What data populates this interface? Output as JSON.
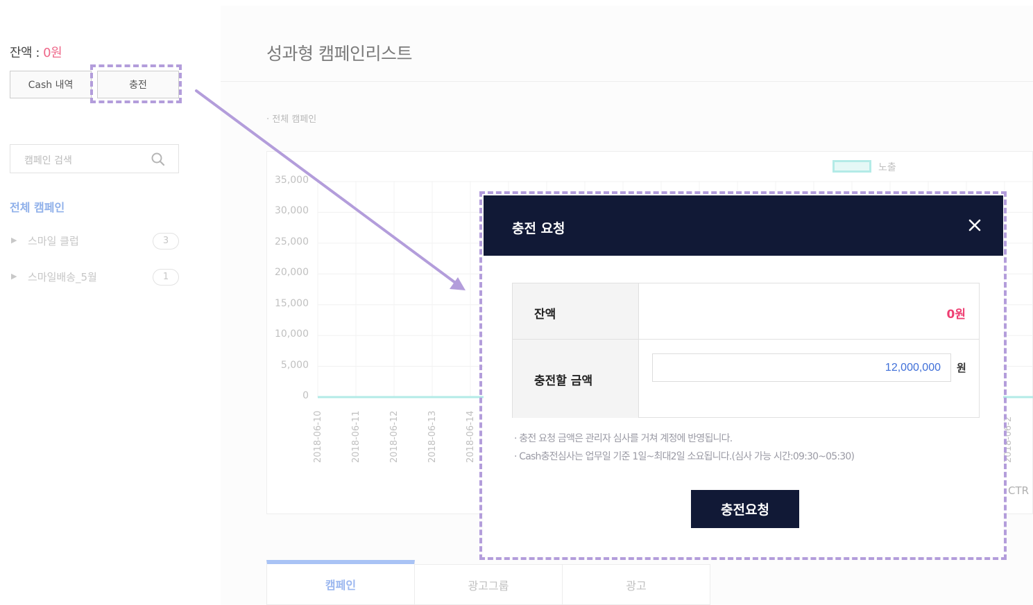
{
  "sidebar": {
    "balance_label": "잔액 : ",
    "balance_value": "0원",
    "cash_history_button": "Cash 내역",
    "charge_button": "충전",
    "search_placeholder": "캠페인 검색",
    "all_campaigns": "전체 캠페인",
    "campaigns": [
      {
        "label": "스마일 클럽",
        "count": "3"
      },
      {
        "label": "스마일배송_5월",
        "count": "1"
      }
    ]
  },
  "main": {
    "page_title": "성과형 캠페인리스트",
    "section_label": "· 전체 캠페인",
    "tabs": [
      {
        "label": "캠페인",
        "active": true
      },
      {
        "label": "광고그룹",
        "active": false
      },
      {
        "label": "광고",
        "active": false
      }
    ],
    "ctr_label": "CTR"
  },
  "chart_data": {
    "type": "line",
    "y_ticks": [
      "35,000",
      "30,000",
      "25,000",
      "20,000",
      "15,000",
      "10,000",
      "5,000",
      "0"
    ],
    "ylim": [
      0,
      35000
    ],
    "x_ticks": [
      "2018-06-10",
      "2018-06-11",
      "2018-06-12",
      "2018-06-13",
      "2018-06-14"
    ],
    "x_tick_partial_right": "2018-06-2",
    "series": [
      {
        "name": "노출",
        "color": "#b3ebe7",
        "values": [
          0,
          0,
          0,
          0,
          0
        ]
      }
    ],
    "legend_position": "top-right",
    "grid": true
  },
  "modal": {
    "title": "충전 요청",
    "balance_label": "잔액",
    "balance_value": "0원",
    "amount_label": "충전할 금액",
    "amount_value": "12,000,000",
    "amount_unit": "원",
    "notices": [
      "· 충전 요청 금액은 관리자 심사를 거쳐 계정에 반영됩니다.",
      "· Cash충전심사는 업무일 기준 1일~최대2일 소요됩니다.(심사 가능 시간:09:30~05:30)"
    ],
    "submit_button": "충전요청"
  },
  "colors": {
    "accent_pink": "#ee3e72",
    "modal_header": "#111936",
    "highlight_dash": "#b39ddb",
    "series_line": "#b3ebe7",
    "tab_active": "#a9c3f5"
  }
}
